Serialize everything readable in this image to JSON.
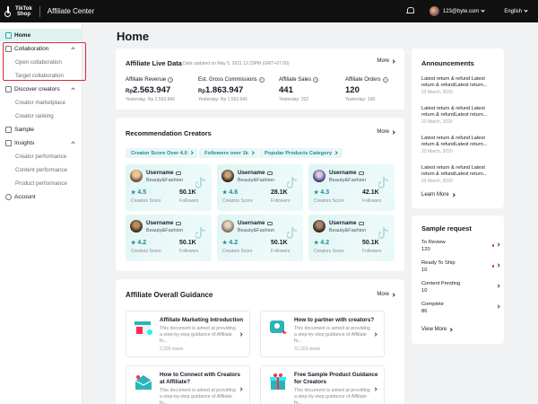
{
  "topbar": {
    "logo_line1": "TikTok",
    "logo_line2": "Shop",
    "app_title": "Affiliate Center",
    "user_email": "123@byte.com",
    "language": "English"
  },
  "sidebar": {
    "home": "Home",
    "collaboration": "Collaboration",
    "open_collaboration": "Open collaboration",
    "target_collaboration": "Target collaboration",
    "discover_creators": "Discover creators",
    "creator_marketplace": "Creator marketplace",
    "creator_ranking": "Creator ranking",
    "sample": "Sample",
    "insights": "Insights",
    "creator_performance": "Creator performance",
    "content_performance": "Content performance",
    "product_performance": "Product performance",
    "account": "Account"
  },
  "page_title": "Home",
  "live_data": {
    "title": "Affiliate Live Data",
    "updated": "Data updated on May 5, 2021 12:23PM (GMT+07:00)",
    "more": "More",
    "stats": [
      {
        "label": "Affiliate Revenue",
        "currency": "Rp",
        "value": "2.563.947",
        "yesterday": "Yesterday: Rp 2.563.946"
      },
      {
        "label": "Est. Gross Commissions",
        "currency": "Rp",
        "value": "1.863.947",
        "yesterday": "Yesterday: Rp 1.563.946"
      },
      {
        "label": "Affiliate Sales",
        "currency": "",
        "value": "441",
        "yesterday": "Yesterday: 332"
      },
      {
        "label": "Affiliate Orders",
        "currency": "",
        "value": "120",
        "yesterday": "Yesterday: 100"
      }
    ]
  },
  "recommend": {
    "title": "Recommendation Creators",
    "more": "More",
    "filters": [
      "Creator Score Over 4.0",
      "Followers over 1k",
      "Popular Products Category"
    ],
    "score_label": "Creators Score",
    "followers_label": "Followers",
    "creators": [
      {
        "username": "Username",
        "category": "Beauty&Fashion",
        "score": "4.5",
        "followers": "50.1K"
      },
      {
        "username": "Username",
        "category": "Beauty&Fashion",
        "score": "4.6",
        "followers": "28.1K"
      },
      {
        "username": "Username",
        "category": "Beauty&Fashion",
        "score": "4.3",
        "followers": "42.1K"
      },
      {
        "username": "Username",
        "category": "Beauty&Fashion",
        "score": "4.2",
        "followers": "50.1K"
      },
      {
        "username": "Username",
        "category": "Beauty&Fashion",
        "score": "4.2",
        "followers": "50.1K"
      },
      {
        "username": "Username",
        "category": "Beauty&Fashion",
        "score": "4.2",
        "followers": "50.1K"
      }
    ]
  },
  "guidance": {
    "title": "Affiliate Overall Guidance",
    "more": "More",
    "items": [
      {
        "title": "Affiliate Marketing Introduction",
        "desc": "This document is aimed at providing a step-by-step guidance of Affiliate fo...",
        "views": "2,203 views"
      },
      {
        "title": "How to partner with creators?",
        "desc": "This document is aimed at providing a step-by-step guidance of Affiliate fo...",
        "views": "31,203 views"
      },
      {
        "title": "How to Connect with Creators at Affiliate?",
        "desc": "This document is aimed at providing a step-by-step guidance of Affiliate fo...",
        "views": ""
      },
      {
        "title": "Free Sample Product Guidance for Creators",
        "desc": "This document is aimed at providing a step-by-step guidance of Affiliate fo...",
        "views": ""
      }
    ]
  },
  "announcements": {
    "title": "Announcements",
    "items": [
      {
        "text": "Latest return & refund Latest return & refundLatest return...",
        "date": "23 March, 2020"
      },
      {
        "text": "Latest return & refund Latest return & refundLatest return...",
        "date": "23 March, 2020"
      },
      {
        "text": "Latest return & refund Latest return & refundLatest return...",
        "date": "23 March, 2020"
      },
      {
        "text": "Latest return & refund Latest return & refundLatest return...",
        "date": "23 March, 2020"
      }
    ],
    "learn_more": "Learn More"
  },
  "sample_request": {
    "title": "Sample request",
    "items": [
      {
        "label": "To Review",
        "count": "120",
        "alert": true
      },
      {
        "label": "Ready To Ship",
        "count": "10",
        "alert": true
      },
      {
        "label": "Content Pending",
        "count": "10",
        "alert": false
      },
      {
        "label": "Complete",
        "count": "86",
        "alert": false
      }
    ],
    "view_more": "View More"
  }
}
